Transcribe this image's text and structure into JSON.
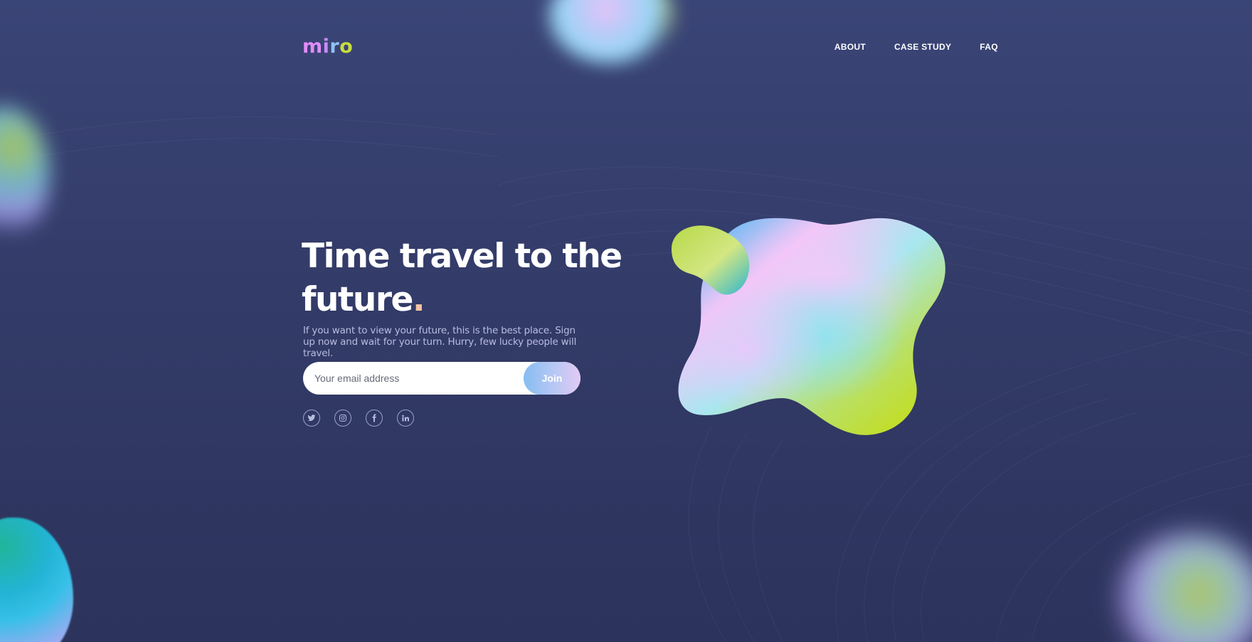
{
  "brand": {
    "logo_letters": [
      "m",
      "i",
      "r",
      "o"
    ],
    "colors": {
      "m": "#e08cf7",
      "i": "#c58df5",
      "r": "#8fc2f2",
      "o": "#c6dd3d"
    }
  },
  "nav": {
    "items": [
      {
        "label": "ABOUT"
      },
      {
        "label": "CASE STUDY"
      },
      {
        "label": "FAQ"
      }
    ]
  },
  "hero": {
    "title_line1": "Time travel to the",
    "title_line2": "future",
    "title_dot": ".",
    "subtitle": "If you want to view your future, this is the best place. Sign up now and wait for your turn. Hurry, few lucky people will travel."
  },
  "signup": {
    "email_placeholder": "Your email address",
    "email_value": "",
    "join_label": "Join"
  },
  "socials": [
    {
      "icon": "twitter-icon"
    },
    {
      "icon": "instagram-icon"
    },
    {
      "icon": "facebook-icon"
    },
    {
      "icon": "linkedin-icon"
    }
  ],
  "theme": {
    "background": "#353d6b",
    "accent_dot": "#f6c4a4",
    "join_gradient_start": "#86bdf2",
    "join_gradient_end": "#e3c9f5"
  }
}
